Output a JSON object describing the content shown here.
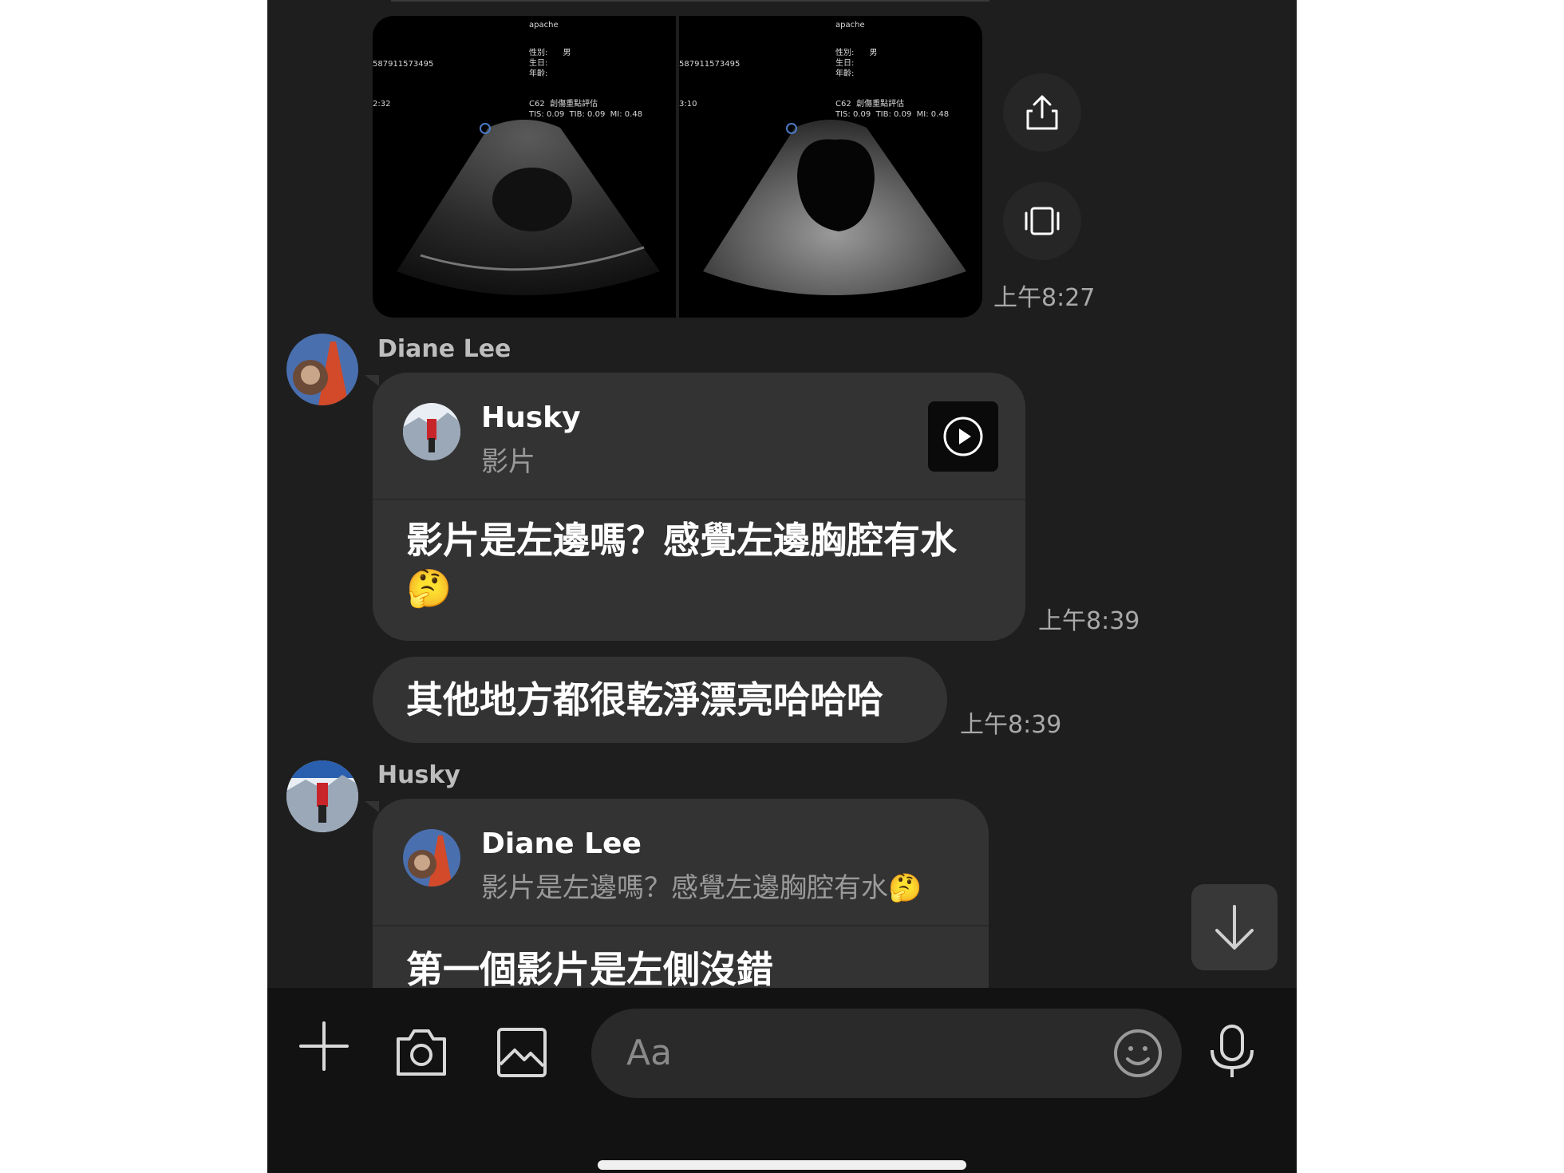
{
  "images": [
    {
      "header": "apache",
      "fields": "性別:      男\n生日:\n年齡:",
      "id": "587911573495",
      "clock": "2:32",
      "probe": "C62  創傷重點評估\nTIS: 0.09  TIB: 0.09  MI: 0.48"
    },
    {
      "header": "apache",
      "fields": "性別:      男\n生日:\n年齡:",
      "id": "587911573495",
      "clock": "3:10",
      "probe": "C62  創傷重點評估\nTIS: 0.09  TIB: 0.09  MI: 0.48"
    }
  ],
  "messages": {
    "img_time": "上午8:27",
    "m1": {
      "sender": "Diane Lee",
      "quote_name": "Husky",
      "quote_sub": "影片",
      "text": "影片是左邊嗎？感覺左邊胸腔有水",
      "emoji": "🤔",
      "time": "上午8:39"
    },
    "m2": {
      "text": "其他地方都很乾淨漂亮哈哈哈",
      "time": "上午8:39"
    },
    "m3": {
      "sender": "Husky",
      "quote_name": "Diane Lee",
      "quote_sub": "影片是左邊嗎？感覺左邊胸腔有水🤔",
      "text": "第一個影片是左側沒錯"
    }
  },
  "input": {
    "placeholder": "Aa"
  },
  "colors": {
    "background": "#1e1e1e",
    "bubble": "#333333",
    "bar": "#121212"
  }
}
